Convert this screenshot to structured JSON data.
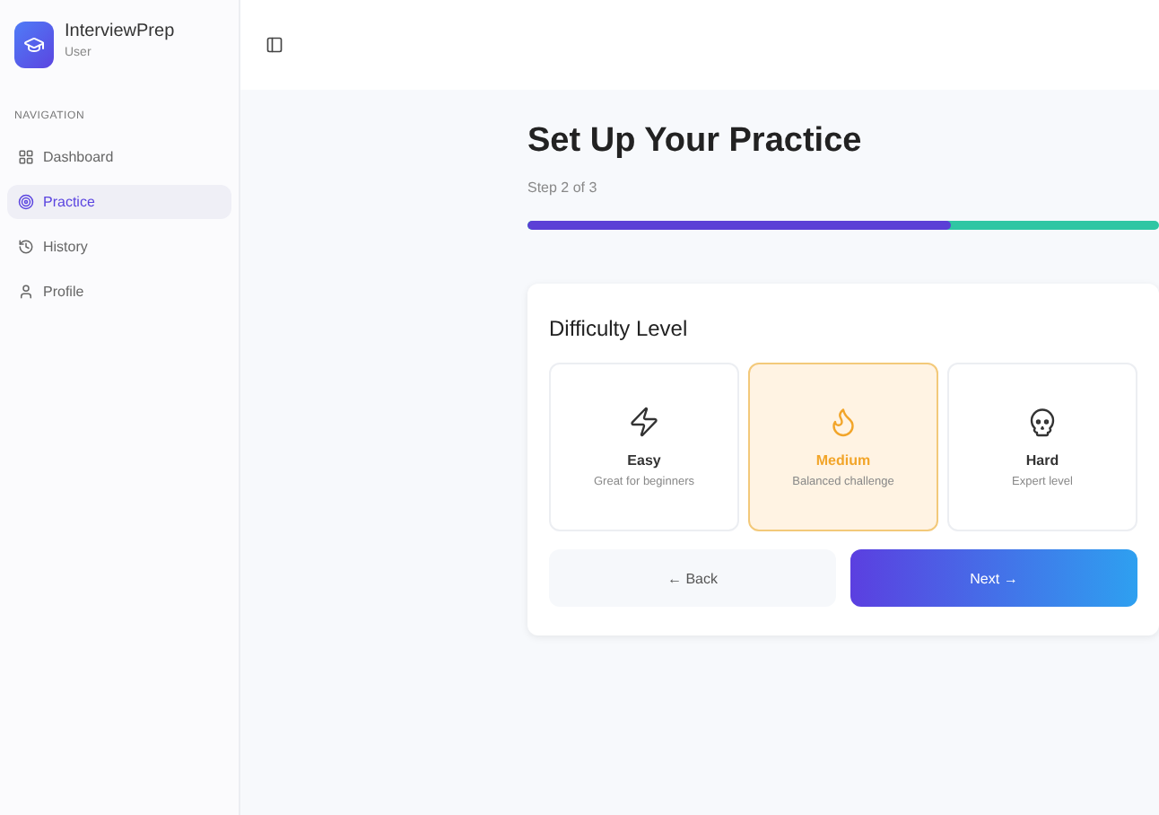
{
  "app": {
    "name": "InterviewPrep",
    "role": "User"
  },
  "sidebar": {
    "section": "NAVIGATION",
    "items": [
      {
        "label": "Dashboard",
        "kind": "dashboard",
        "selected": false
      },
      {
        "label": "Practice",
        "kind": "practice",
        "selected": true
      },
      {
        "label": "History",
        "kind": "history",
        "selected": false
      },
      {
        "label": "Profile",
        "kind": "profile",
        "selected": false
      }
    ]
  },
  "page": {
    "title": "Set Up Your Practice",
    "step": "Step 2 of 3",
    "progress": {
      "level": 0.67
    }
  },
  "difficulty": {
    "title": "Difficulty Level",
    "options": [
      {
        "label": "Easy",
        "description": "Great for beginners",
        "kind": "easy",
        "selected": false
      },
      {
        "label": "Medium",
        "description": "Balanced challenge",
        "kind": "medium",
        "selected": true
      },
      {
        "label": "Hard",
        "description": "Expert level",
        "kind": "hard",
        "selected": false
      }
    ]
  },
  "buttons": {
    "back": "← Back",
    "next": "Next →"
  }
}
